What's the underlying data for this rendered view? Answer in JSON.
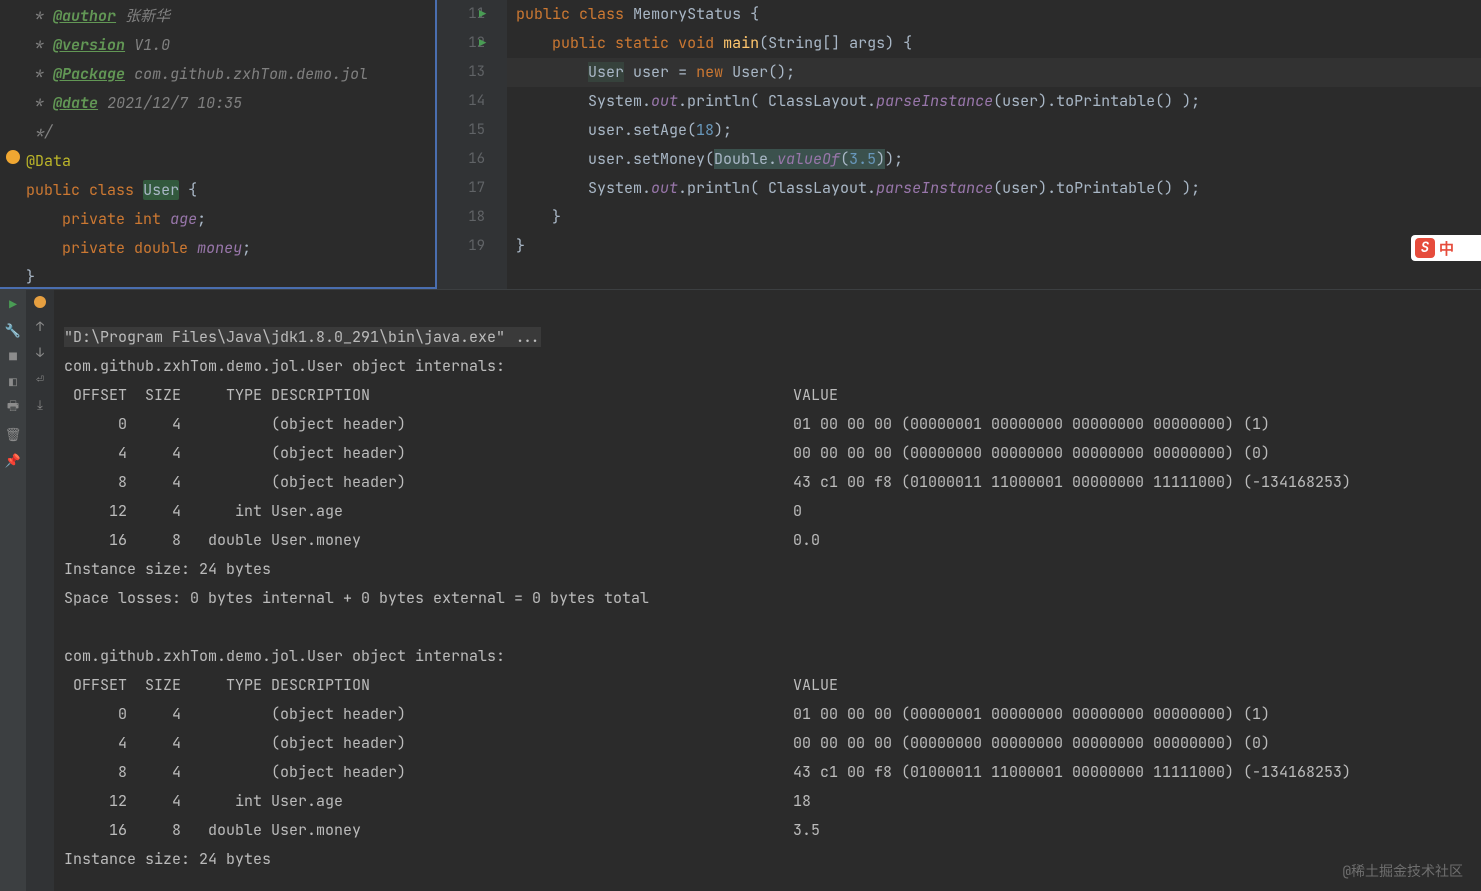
{
  "left_editor": {
    "javadoc": {
      "author_tag": "@author",
      "author_val": "张新华",
      "version_tag": "@version",
      "version_val": "V1.0",
      "package_tag": "@Package",
      "package_val": "com.github.zxhTom.demo.jol",
      "date_tag": "@date",
      "date_val": "2021/12/7 10:35"
    },
    "annotation": "@Data",
    "decl_public": "public",
    "decl_class": "class",
    "class_name": "User",
    "field1_mod": "private",
    "field1_type": "int",
    "field1_name": "age",
    "field2_mod": "private",
    "field2_type": "double",
    "field2_name": "money"
  },
  "right_editor": {
    "lines": [
      "11",
      "12",
      "13",
      "14",
      "15",
      "16",
      "17",
      "18",
      "19"
    ],
    "l11": {
      "public": "public",
      "class": "class",
      "name": "MemoryStatus"
    },
    "l12": {
      "public": "public",
      "static": "static",
      "void": "void",
      "main": "main",
      "args": "(String[] args) {"
    },
    "l13": {
      "type": "User",
      "var": "user",
      "eq": "=",
      "new": "new",
      "ctor": "User",
      "tail": "();"
    },
    "l14": {
      "sys": "System.",
      "out": "out",
      "call": ".println( ClassLayout.",
      "pi": "parseInstance",
      "args": "(user).toPrintable() );"
    },
    "l15": {
      "pre": "user.setAge(",
      "num": "18",
      "post": ");"
    },
    "l16": {
      "pre": "user.setMoney(",
      "dbl": "Double.",
      "vof": "valueOf",
      "open": "(",
      "num": "3.5",
      "close": ")",
      "post": ");"
    },
    "l17": {
      "sys": "System.",
      "out": "out",
      "call": ".println( ClassLayout.",
      "pi": "parseInstance",
      "args": "(user).toPrintable() );"
    }
  },
  "console": {
    "cmd": "\"D:\\Program Files\\Java\\jdk1.8.0_291\\bin\\java.exe\" ...",
    "header1": "com.github.zxhTom.demo.jol.User object internals:",
    "cols": " OFFSET  SIZE     TYPE DESCRIPTION                                               VALUE",
    "r1": "      0     4          (object header)                                           01 00 00 00 (00000001 00000000 00000000 00000000) (1)",
    "r2": "      4     4          (object header)                                           00 00 00 00 (00000000 00000000 00000000 00000000) (0)",
    "r3": "      8     4          (object header)                                           43 c1 00 f8 (01000011 11000001 00000000 11111000) (-134168253)",
    "r4": "     12     4      int User.age                                                  0",
    "r5": "     16     8   double User.money                                                0.0",
    "inst1": "Instance size: 24 bytes",
    "loss": "Space losses: 0 bytes internal + 0 bytes external = 0 bytes total",
    "header2": "com.github.zxhTom.demo.jol.User object internals:",
    "cols2": " OFFSET  SIZE     TYPE DESCRIPTION                                               VALUE",
    "s1": "      0     4          (object header)                                           01 00 00 00 (00000001 00000000 00000000 00000000) (1)",
    "s2": "      4     4          (object header)                                           00 00 00 00 (00000000 00000000 00000000 00000000) (0)",
    "s3": "      8     4          (object header)                                           43 c1 00 f8 (01000011 11000001 00000000 11111000) (-134168253)",
    "s4": "     12     4      int User.age                                                  18",
    "s5": "     16     8   double User.money                                                3.5",
    "inst2": "Instance size: 24 bytes"
  },
  "ime": {
    "glyph": "S",
    "lang": "中"
  },
  "watermark": "@稀土掘金技术社区"
}
